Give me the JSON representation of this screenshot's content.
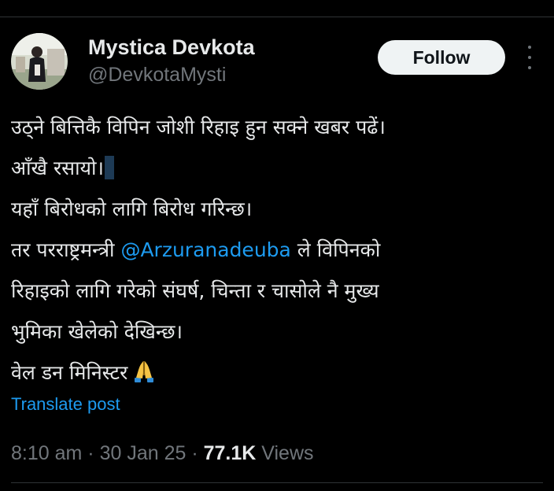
{
  "author": {
    "display_name": "Mystica Devkota",
    "handle": "@DevkotaMysti"
  },
  "follow_label": "Follow",
  "tweet": {
    "line1": "उठ्ने बित्तिकै विपिन जोशी रिहाइ हुन सक्ने खबर पढें।",
    "line2": "आँखै रसायो।",
    "line3": "यहाँ बिरोधको लागि बिरोध गरिन्छ।",
    "line4_prefix": "तर परराष्ट्रमन्त्री ",
    "mention": "@Arzuranadeuba",
    "line4_suffix": " ले विपिनको",
    "line5": "रिहाइको लागि गरेको संघर्ष, चिन्ता र चासोले नै मुख्य",
    "line6": "भुमिका खेलेको देखिन्छ।",
    "line7": "वेल डन मिनिस्टर",
    "emoji": "folded-hands"
  },
  "translate_label": "Translate post",
  "meta": {
    "time": "8:10 am",
    "separator": " · ",
    "date": "30 Jan 25",
    "views_count": "77.1K",
    "views_label": " Views"
  },
  "colors": {
    "background": "#000000",
    "text_primary": "#e7e9ea",
    "text_secondary": "#71767b",
    "link": "#1d9bf0",
    "follow_bg": "#eff3f4"
  }
}
